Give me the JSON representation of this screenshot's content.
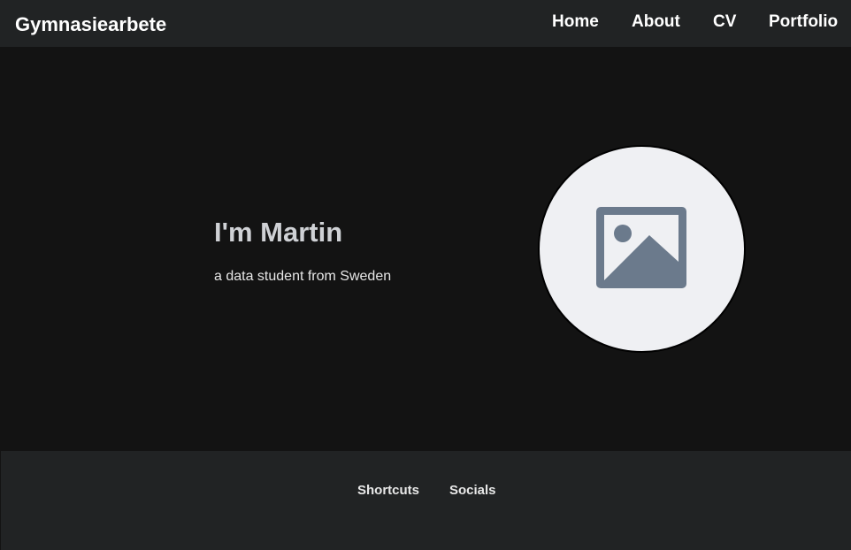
{
  "navbar": {
    "brand": "Gymnasiearbete",
    "links": [
      {
        "label": "Home"
      },
      {
        "label": "About"
      },
      {
        "label": "CV"
      },
      {
        "label": "Portfolio"
      }
    ]
  },
  "hero": {
    "title": "I'm Martin",
    "subtitle": "a data student from Sweden",
    "avatar_icon": "image-placeholder-icon"
  },
  "footer": {
    "links": [
      {
        "label": "Shortcuts"
      },
      {
        "label": "Socials"
      }
    ]
  },
  "colors": {
    "page_background": "#131313",
    "bar_background": "#212324",
    "placeholder_background": "#eff0f3",
    "placeholder_icon": "#6b7a8c"
  }
}
